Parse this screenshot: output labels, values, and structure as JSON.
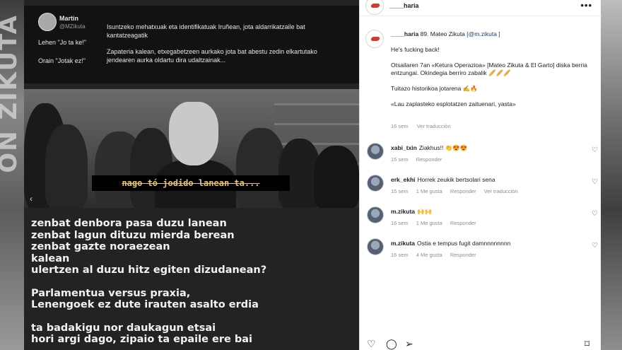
{
  "background": {
    "poster_text": "ON ZIKUTA"
  },
  "media": {
    "tweet": {
      "name": "Martin",
      "handle": "@MZikuta",
      "label1": "Lehen \"Jo ta ke!\"",
      "label2": "Orain \"Jotak ez!\"",
      "text1": "Isuntzeko mehatxuak eta identifikatuak Iruñean, jota aldarrikatzaile bat kantatzeagatik",
      "text2": "Zapateria kalean, etxegabetzeen aurkako jota bat abestu zedin elkartutako jendearen aurka oldartu dira udaltzainak..."
    },
    "photo_caption": "nago tó jodido lanean ta...",
    "carousel_prev_icon": "chevron-left-icon",
    "lyrics": {
      "stanza1": [
        "zenbat denbora pasa duzu lanean",
        "zenbat lagun dituzu mierda berean",
        "zenbat gazte noraezean",
        "kalean",
        "ulertzen al duzu hitz egiten dizudanean?"
      ],
      "stanza2": [
        "Parlamentua versus praxia,",
        "Lenengoek ez dute irauten asalto erdia"
      ],
      "stanza3": [
        "ta badakigu nor daukagun etsai",
        "hori argi dago, zipaio ta epaile ere bai"
      ]
    }
  },
  "panel": {
    "header": {
      "username": "____haria",
      "more_icon": "more-horizontal-icon",
      "more_label": "•••"
    },
    "caption": {
      "username": "____haria",
      "text_after_user": " 89. Mateo Zikuta ",
      "mention": "[@m.zikuta ]",
      "line2": "He's fucking back!",
      "line3": "Otsailaren 7an «Ketura Operazioa» [Mateo Zikuta & El Garto] diska berria entzungai. Okindegia berriro zabalik 🥖🥖🥖",
      "line4": "Tuitazo historikoa jotarena ✍️🔥",
      "line5": "«Lau zaplasteko esplotatzen zaituenari, yasta»",
      "time": "16 sem",
      "translate": "Ver traducción"
    },
    "comments": [
      {
        "user": "xabi_txin",
        "text": "Ziakhus!! 👏😍😍",
        "time": "15 sem",
        "likes": "",
        "reply": "Responder",
        "translate": ""
      },
      {
        "user": "erk_ekhi",
        "text": "Horrek zeukik bertsolari sena",
        "time": "15 sem",
        "likes": "1 Me gusta",
        "reply": "Responder",
        "translate": "Ver traducción"
      },
      {
        "user": "m.zikuta",
        "text": "🙌🙌",
        "time": "16 sem",
        "likes": "1 Me gusta",
        "reply": "Responder",
        "translate": ""
      },
      {
        "user": "m.zikuta",
        "text": "Ostia e tempus fugit damnnnnnnnn",
        "time": "16 sem",
        "likes": "4 Me gusta",
        "reply": "Responder",
        "translate": ""
      }
    ],
    "heart_icon": "heart-outline-icon",
    "actions": {
      "like_icon": "heart-icon",
      "comment_icon": "comment-icon",
      "share_icon": "send-icon",
      "save_icon": "bookmark-icon"
    }
  }
}
